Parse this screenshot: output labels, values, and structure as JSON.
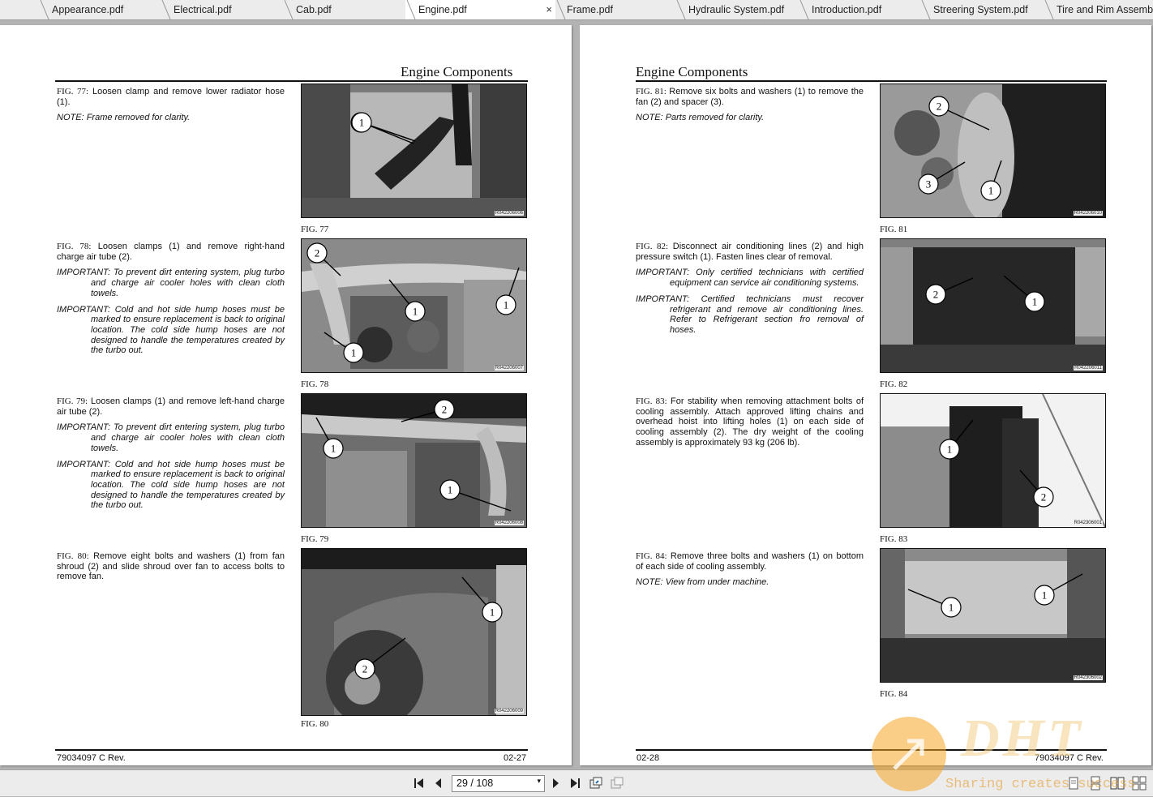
{
  "tabs": [
    {
      "label": "Appearance.pdf"
    },
    {
      "label": "Electrical.pdf"
    },
    {
      "label": "Cab.pdf"
    },
    {
      "label": "Engine.pdf",
      "active": true
    },
    {
      "label": "Frame.pdf"
    },
    {
      "label": "Hydraulic System.pdf"
    },
    {
      "label": "Introduction.pdf"
    },
    {
      "label": "Streering System.pdf"
    },
    {
      "label": "Tire and Rim Assembly.pdf"
    }
  ],
  "close_glyph": "×",
  "left_page": {
    "title": "Engine Components",
    "footer_doc": "79034097 C Rev.",
    "footer_page": "02-27",
    "figures": [
      {
        "fig": "FIG. 77:",
        "text": "Loosen clamp and remove lower radiator hose (1).",
        "notes": [
          {
            "label": "NOTE:",
            "text": "Frame removed for clarity."
          }
        ],
        "label": "FIG. 77",
        "ref": "R042206006",
        "callouts": [
          "1"
        ]
      },
      {
        "fig": "FIG. 78:",
        "text": "Loosen clamps (1) and remove right-hand charge air tube (2).",
        "notes": [
          {
            "label": "IMPORTANT:",
            "text": "To prevent dirt entering system, plug turbo and charge air cooler holes with clean cloth towels."
          },
          {
            "label": "IMPORTANT:",
            "text": "Cold and hot side hump hoses must be marked to ensure replacement is back to original location. The cold side hump hoses are not designed to handle the temperatures created by the turbo out."
          }
        ],
        "label": "FIG. 78",
        "ref": "R042206007",
        "callouts": [
          "2",
          "1",
          "1",
          "1"
        ]
      },
      {
        "fig": "FIG. 79:",
        "text": "Loosen clamps (1) and remove left-hand charge air tube (2).",
        "notes": [
          {
            "label": "IMPORTANT:",
            "text": "To prevent dirt entering system, plug turbo and charge air cooler holes with clean cloth towels."
          },
          {
            "label": "IMPORTANT:",
            "text": "Cold and hot side hump hoses must be marked to ensure replacement is back to original location. The cold side hump hoses are not designed to handle the temperatures created by the turbo out."
          }
        ],
        "label": "FIG. 79",
        "ref": "R042206008",
        "callouts": [
          "2",
          "1",
          "1"
        ]
      },
      {
        "fig": "FIG. 80:",
        "text": "Remove eight bolts and washers (1) from fan shroud (2) and slide shroud over fan to access bolts to remove fan.",
        "notes": [],
        "label": "FIG. 80",
        "ref": "R042206009",
        "callouts": [
          "1",
          "2"
        ]
      }
    ]
  },
  "right_page": {
    "title": "Engine Components",
    "footer_doc": "79034097 C Rev.",
    "footer_page": "02-28",
    "figures": [
      {
        "fig": "FIG. 81:",
        "text": "Remove six bolts and washers (1) to remove the fan (2) and spacer (3).",
        "notes": [
          {
            "label": "NOTE:",
            "text": "Parts removed for clarity."
          }
        ],
        "label": "FIG. 81",
        "ref": "R042206010",
        "callouts": [
          "2",
          "3",
          "1"
        ]
      },
      {
        "fig": "FIG. 82:",
        "text": "Disconnect air conditioning lines (2) and high pressure switch (1). Fasten lines clear of removal.",
        "notes": [
          {
            "label": "IMPORTANT:",
            "text": "Only certified technicians with certified equipment can service air conditioning systems."
          },
          {
            "label": "IMPORTANT:",
            "text": "Certified technicians must recover refrigerant and remove air conditioning lines. Refer to Refrigerant section fro removal of hoses."
          }
        ],
        "label": "FIG. 82",
        "ref": "R042206011",
        "callouts": [
          "2",
          "1"
        ]
      },
      {
        "fig": "FIG. 83:",
        "text": "For stability when removing attachment bolts of cooling assembly. Attach approved lifting chains and overhead hoist into lifting holes (1) on each side of cooling assembly (2). The dry weight of the cooling assembly is approximately 93 kg (206 lb).",
        "notes": [],
        "label": "FIG. 83",
        "ref": "R042306001",
        "callouts": [
          "1",
          "2"
        ]
      },
      {
        "fig": "FIG. 84:",
        "text": "Remove three bolts and washers (1) on bottom of each side of cooling assembly.",
        "notes": [
          {
            "label": "NOTE:",
            "text": "View from under machine."
          }
        ],
        "label": "FIG. 84",
        "ref": "R042306002",
        "callouts": [
          "1",
          "1"
        ]
      }
    ]
  },
  "toolbar": {
    "page_display": "29 / 108",
    "dropdown_glyph": "▾"
  },
  "watermark": {
    "logo": "DHT",
    "tagline": "Sharing creates success"
  }
}
